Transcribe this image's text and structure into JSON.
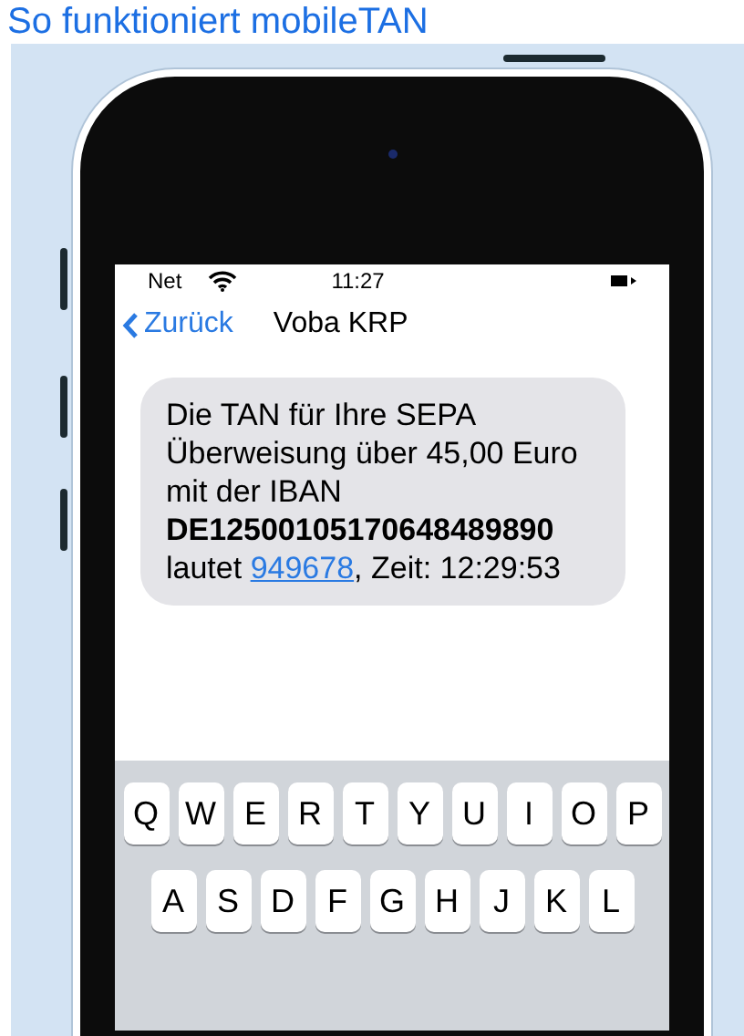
{
  "page_title": "So funktioniert mobileTAN",
  "status_bar": {
    "carrier": "Net",
    "time": "11:27"
  },
  "nav_bar": {
    "back": "Zurück",
    "title": "Voba KRP"
  },
  "message": {
    "text_before": "Die TAN für Ihre SEPA Überweisung über 45,00 Euro mit der IBAN **DE12500105170648489890** lautet",
    "link": "949678",
    "text_after": ", Zeit: 12:29:53"
  },
  "keyboard": {
    "rows": [
      [
        "Q",
        "W",
        "E",
        "R",
        "T",
        "Y",
        "U",
        "I",
        "O",
        "P"
      ],
      [
        "A",
        "S",
        "D",
        "F",
        "G",
        "H",
        "J",
        "K",
        "L"
      ]
    ]
  }
}
